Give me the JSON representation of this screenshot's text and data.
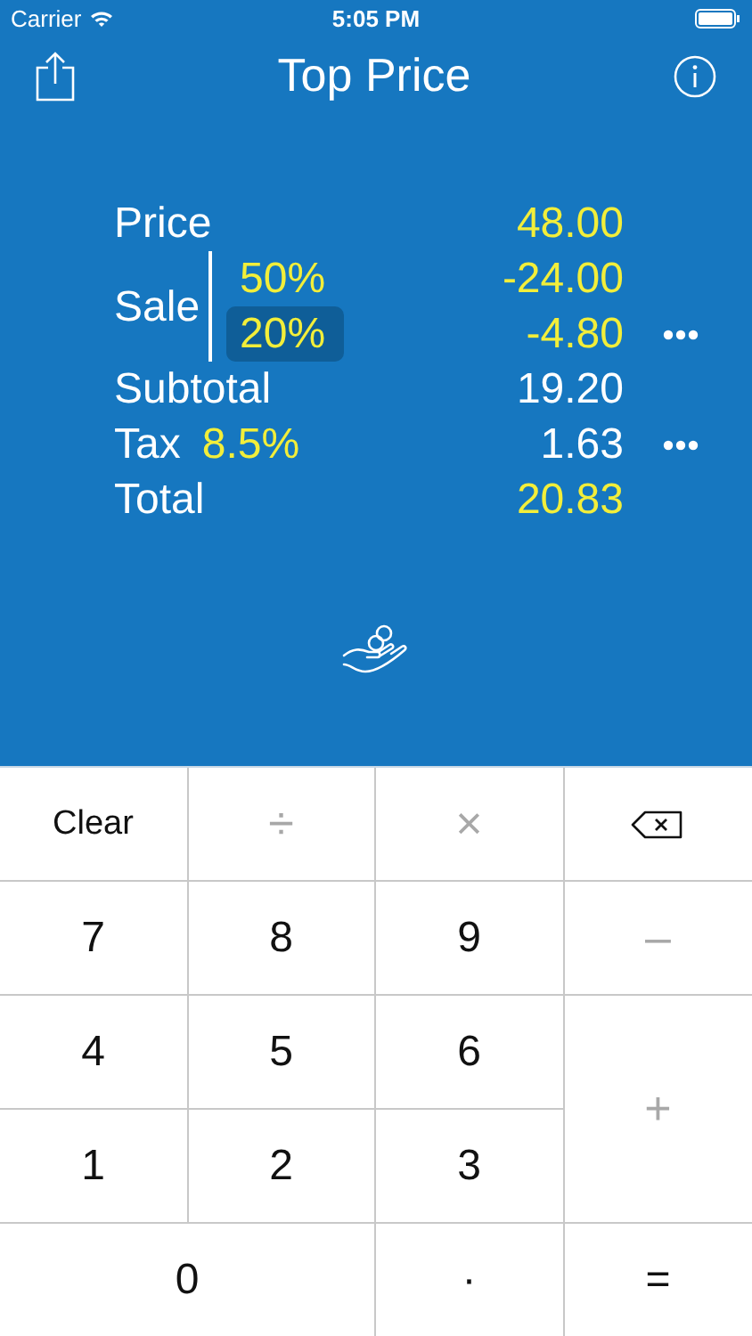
{
  "status_bar": {
    "carrier": "Carrier",
    "time": "5:05 PM"
  },
  "nav": {
    "title": "Top Price"
  },
  "lines": [
    {
      "kind": "simple",
      "label": "Price",
      "value": "48.00",
      "color": "#f2ee3a"
    },
    {
      "kind": "group",
      "label": "Sale",
      "rates": [
        {
          "rate": "50%",
          "value": "-24.00",
          "selected": false,
          "more": false
        },
        {
          "rate": "20%",
          "value": "-4.80",
          "selected": true,
          "more": true
        }
      ]
    },
    {
      "kind": "simple",
      "label": "Subtotal",
      "value": "19.20",
      "color": "#ffffff"
    },
    {
      "kind": "rate",
      "label": "Tax",
      "rate": "8.5%",
      "value": "1.63",
      "color": "#ffffff",
      "more": true
    },
    {
      "kind": "simple",
      "label": "Total",
      "value": "20.83",
      "color": "#f2ee3a"
    }
  ],
  "keypad": [
    {
      "label": "Clear",
      "kind": "text"
    },
    {
      "label": "÷",
      "kind": "op"
    },
    {
      "label": "×",
      "kind": "op"
    },
    {
      "kind": "delete"
    },
    {
      "label": "7",
      "kind": "digit"
    },
    {
      "label": "8",
      "kind": "digit"
    },
    {
      "label": "9",
      "kind": "digit"
    },
    {
      "label": "–",
      "kind": "op"
    },
    {
      "label": "4",
      "kind": "digit"
    },
    {
      "label": "5",
      "kind": "digit"
    },
    {
      "label": "6",
      "kind": "digit"
    },
    {
      "label": "+",
      "kind": "op"
    },
    {
      "label": "1",
      "kind": "digit"
    },
    {
      "label": "2",
      "kind": "digit"
    },
    {
      "label": "3",
      "kind": "digit"
    },
    {
      "label": "0",
      "kind": "digit"
    },
    {
      "label": "·",
      "kind": "digit"
    },
    {
      "label": "=",
      "kind": "digit"
    }
  ]
}
